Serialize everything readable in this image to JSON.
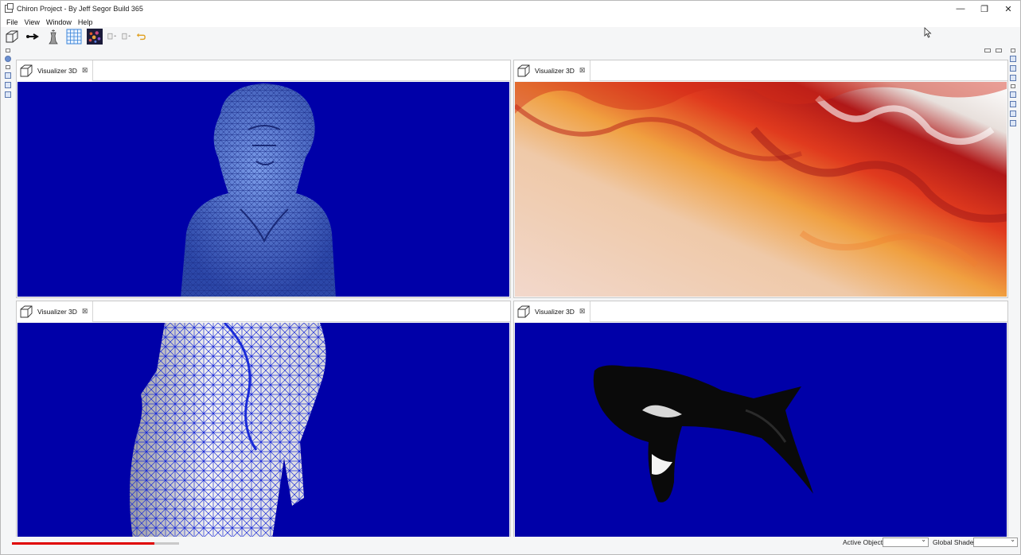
{
  "window": {
    "title": "Chiron Project - By Jeff Segor Build 365",
    "controls": {
      "minimize": "—",
      "restore": "❐",
      "close": "✕"
    }
  },
  "menu": [
    "File",
    "View",
    "Window",
    "Help"
  ],
  "toolbar": {
    "icons": [
      "wireframe-cube-icon",
      "arrow-right-icon",
      "chess-piece-icon",
      "grid-icon",
      "particles-icon",
      "import-icon",
      "export-icon",
      "undo-icon"
    ]
  },
  "panels": [
    {
      "tab_label": "Visualizer 3D",
      "close": "⊠",
      "content": "bust-mesh"
    },
    {
      "tab_label": "Visualizer 3D",
      "close": "⊠",
      "content": "terrain"
    },
    {
      "tab_label": "Visualizer 3D",
      "close": "⊠",
      "content": "wireframe-bust"
    },
    {
      "tab_label": "Visualizer 3D",
      "close": "⊠",
      "content": "orca"
    }
  ],
  "status": {
    "active_object_label": "Active Object",
    "global_shader_label": "Global Shader",
    "progress": 0.85
  },
  "colors": {
    "viewport_bg": "#0000a8",
    "accent": "#e00000"
  }
}
